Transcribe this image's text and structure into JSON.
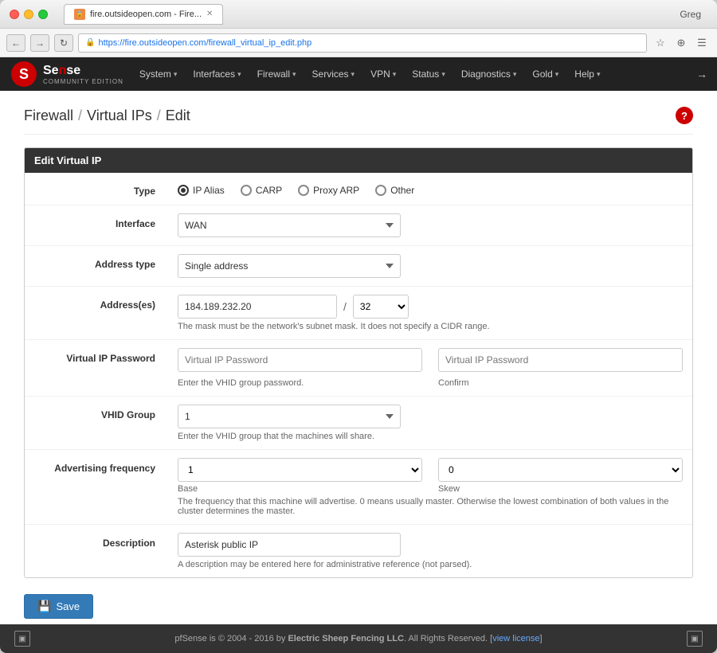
{
  "browser": {
    "tab_title": "fire.outsideopen.com - Fire...",
    "url": "https://fire.outsideopen.com/firewall_virtual_ip_edit.php",
    "user": "Greg"
  },
  "nav": {
    "logo_text": "Sense",
    "logo_sub": "COMMUNITY EDITION",
    "items": [
      {
        "label": "System",
        "id": "system"
      },
      {
        "label": "Interfaces",
        "id": "interfaces"
      },
      {
        "label": "Firewall",
        "id": "firewall"
      },
      {
        "label": "Services",
        "id": "services"
      },
      {
        "label": "VPN",
        "id": "vpn"
      },
      {
        "label": "Status",
        "id": "status"
      },
      {
        "label": "Diagnostics",
        "id": "diagnostics"
      },
      {
        "label": "Gold",
        "id": "gold"
      },
      {
        "label": "Help",
        "id": "help"
      }
    ]
  },
  "breadcrumb": {
    "part1": "Firewall",
    "part2": "Virtual IPs",
    "part3": "Edit"
  },
  "panel": {
    "header": "Edit Virtual IP"
  },
  "form": {
    "type_label": "Type",
    "type_options": [
      {
        "label": "IP Alias",
        "selected": true
      },
      {
        "label": "CARP",
        "selected": false
      },
      {
        "label": "Proxy ARP",
        "selected": false
      },
      {
        "label": "Other",
        "selected": false
      }
    ],
    "interface_label": "Interface",
    "interface_value": "WAN",
    "address_type_label": "Address type",
    "address_type_value": "Single address",
    "addresses_label": "Address(es)",
    "address_value": "184.189.232.20",
    "address_hint": "The mask must be the network's subnet mask. It does not specify a CIDR range.",
    "cidr_sep": "/",
    "cidr_value": "32",
    "vip_password_label": "Virtual IP Password",
    "vip_password_placeholder": "Virtual IP Password",
    "vip_password_confirm_placeholder": "Virtual IP Password",
    "vip_password_hint": "Enter the VHID group password.",
    "vip_password_confirm_label": "Confirm",
    "vhid_label": "VHID Group",
    "vhid_value": "1",
    "vhid_hint": "Enter the VHID group that the machines will share.",
    "adv_freq_label": "Advertising frequency",
    "adv_base_value": "1",
    "adv_skew_value": "0",
    "adv_base_label": "Base",
    "adv_skew_label": "Skew",
    "adv_hint": "The frequency that this machine will advertise. 0 means usually master. Otherwise the lowest combination of both values in the cluster determines the master.",
    "description_label": "Description",
    "description_value": "Asterisk public IP",
    "description_hint": "A description may be entered here for administrative reference (not parsed).",
    "save_label": "Save"
  },
  "footer": {
    "copyright": "pfSense",
    "text": "is © 2004 - 2016 by",
    "company": "Electric Sheep Fencing LLC",
    "rights": ". All Rights Reserved. [",
    "license_link": "view license",
    "close": "]"
  }
}
